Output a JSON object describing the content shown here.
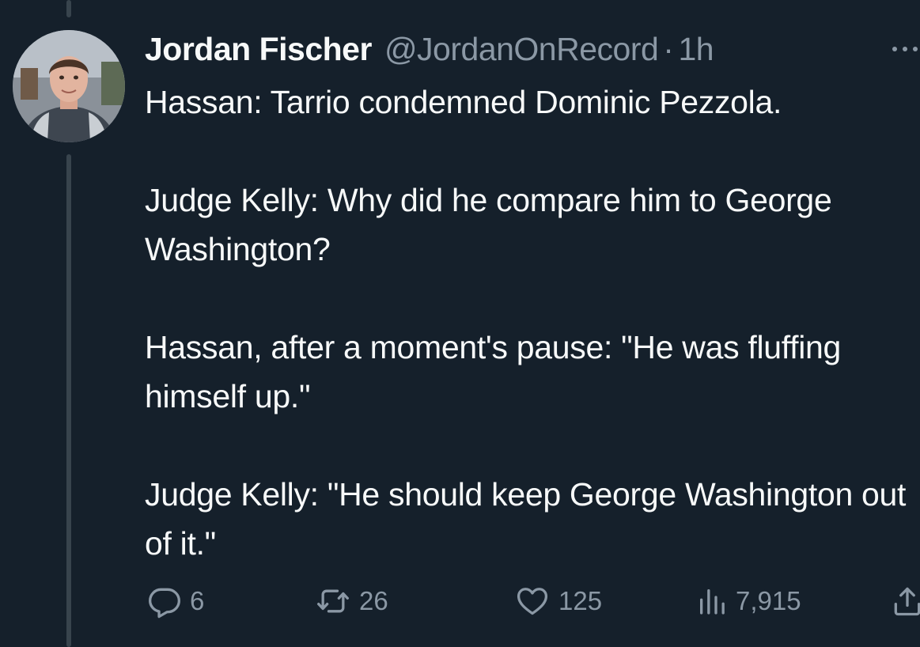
{
  "tweet": {
    "author": {
      "display_name": "Jordan Fischer",
      "handle": "@JordanOnRecord",
      "avatar_icon": "profile-photo"
    },
    "separator": "·",
    "time": "1h",
    "paragraphs": [
      "Hassan: Tarrio condemned Dominic Pezzola.",
      "Judge Kelly: Why did he compare him to George Washington?",
      "Hassan, after a moment's pause: \"He was fluffing himself up.\"",
      "Judge Kelly: \"He should keep George Washington out of it.\""
    ]
  },
  "actions": {
    "replies": "6",
    "retweets": "26",
    "likes": "125",
    "views": "7,915"
  },
  "colors": {
    "background": "#15202b",
    "text": "#f7f9f9",
    "secondary": "#8b98a5",
    "thread_line": "#38444d"
  }
}
